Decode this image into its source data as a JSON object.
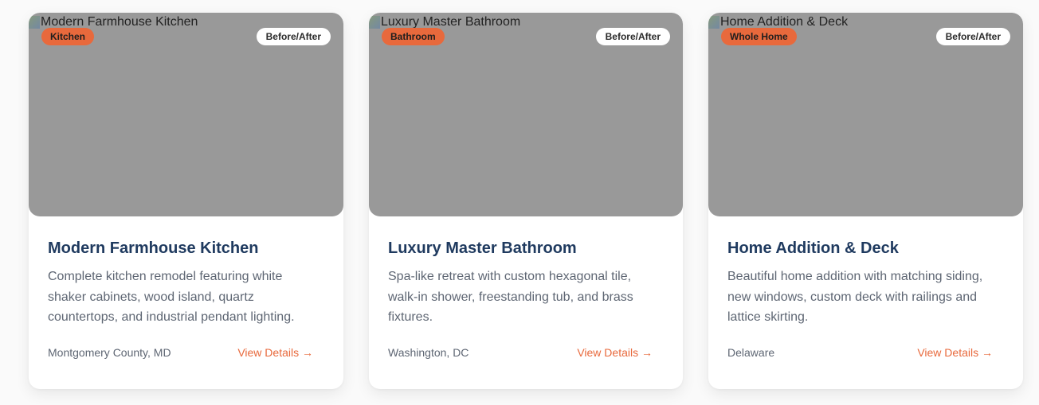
{
  "projects": [
    {
      "image_alt": "Modern Farmhouse Kitchen",
      "category": "Kitchen",
      "badge": "Before/After",
      "title": "Modern Farmhouse Kitchen",
      "description": "Complete kitchen remodel featuring white shaker cabinets, wood island, quartz countertops, and industrial pendant lighting.",
      "location": "Montgomery County, MD",
      "link": "View Details →"
    },
    {
      "image_alt": "Luxury Master Bathroom",
      "category": "Bathroom",
      "badge": "Before/After",
      "title": "Luxury Master Bathroom",
      "description": "Spa-like retreat with custom hexagonal tile, walk-in shower, freestanding tub, and brass fixtures.",
      "location": "Washington, DC",
      "link": "View Details →"
    },
    {
      "image_alt": "Home Addition & Deck",
      "category": "Whole Home",
      "badge": "Before/After",
      "title": "Home Addition & Deck",
      "description": "Beautiful home addition with matching siding, new windows, custom deck with railings and lattice skirting.",
      "location": "Delaware",
      "link": "View Details →"
    }
  ],
  "colors": {
    "accent": "#e8693c",
    "title": "#1f3a5f",
    "image_placeholder": "#999999"
  }
}
